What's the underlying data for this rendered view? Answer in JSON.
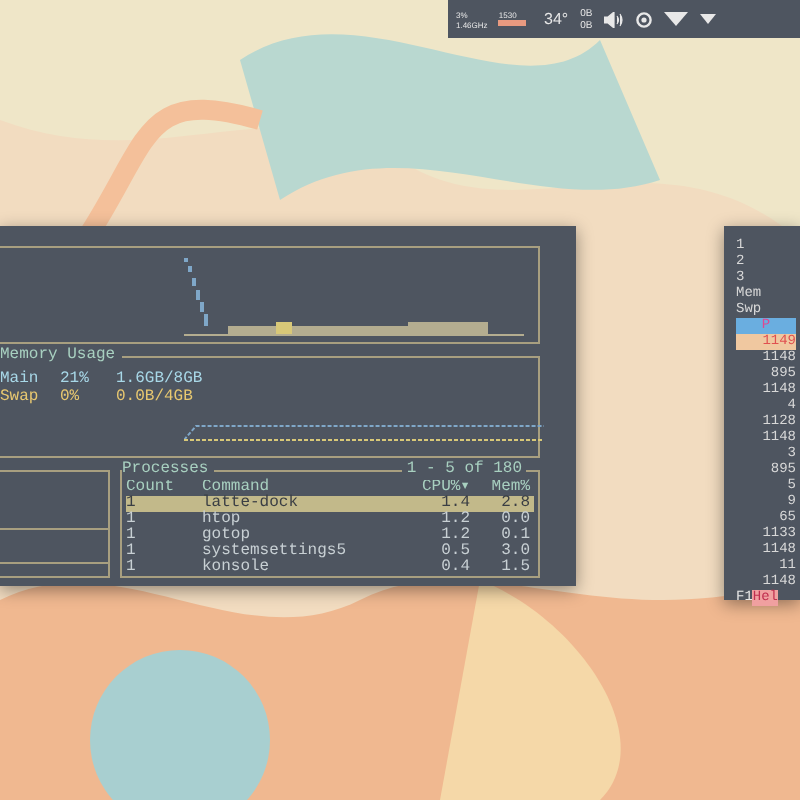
{
  "panel": {
    "meters": [
      {
        "text": "3%"
      },
      {
        "text": "1530"
      },
      {
        "text": "1.46GHz"
      }
    ],
    "temperature": "34°",
    "network": [
      "0B",
      "0B"
    ]
  },
  "main_window": {
    "memory": {
      "title": "Memory Usage",
      "rows": [
        {
          "name": "Main",
          "percent": "21%",
          "amount": "1.6GB/8GB",
          "color": "#a8d8e8"
        },
        {
          "name": "Swap",
          "percent": "0%",
          "amount": "0.0B/4GB",
          "color": "#e8c870"
        }
      ]
    },
    "processes": {
      "title": "Processes",
      "range": "1 - 5 of 180",
      "columns": [
        "Count",
        "Command",
        "CPU%▾",
        "Mem%"
      ],
      "rows": [
        {
          "cells": [
            "1",
            "latte-dock",
            "1.4",
            "2.8"
          ],
          "selected": true
        },
        {
          "cells": [
            "1",
            "htop",
            "1.2",
            "0.0"
          ],
          "selected": false
        },
        {
          "cells": [
            "1",
            "gotop",
            "1.2",
            "0.1"
          ],
          "selected": false
        },
        {
          "cells": [
            "1",
            "systemsettings5",
            "0.5",
            "3.0"
          ],
          "selected": false
        },
        {
          "cells": [
            "1",
            "konsole",
            "0.4",
            "1.5"
          ],
          "selected": false
        }
      ]
    }
  },
  "side_window": {
    "lines": [
      {
        "text": "1",
        "kind": "plain"
      },
      {
        "text": "2",
        "kind": "plain"
      },
      {
        "text": "3",
        "kind": "plain"
      },
      {
        "text": "Mem",
        "kind": "plain"
      },
      {
        "text": "Swp",
        "kind": "plain"
      },
      {
        "text": "P",
        "kind": "header"
      },
      {
        "text": "1149",
        "kind": "selected"
      },
      {
        "text": "1148",
        "kind": "row"
      },
      {
        "text": "895",
        "kind": "row"
      },
      {
        "text": "1148",
        "kind": "row"
      },
      {
        "text": "4",
        "kind": "row"
      },
      {
        "text": "1128",
        "kind": "row"
      },
      {
        "text": "1148",
        "kind": "row"
      },
      {
        "text": "3",
        "kind": "row"
      },
      {
        "text": "895",
        "kind": "row"
      },
      {
        "text": "5",
        "kind": "row"
      },
      {
        "text": "9",
        "kind": "row"
      },
      {
        "text": "65",
        "kind": "row"
      },
      {
        "text": "1133",
        "kind": "row"
      },
      {
        "text": "1148",
        "kind": "row"
      },
      {
        "text": "11",
        "kind": "row"
      },
      {
        "text": "1148",
        "kind": "row"
      }
    ],
    "footer": {
      "key": "F1",
      "label": "Hel"
    }
  }
}
